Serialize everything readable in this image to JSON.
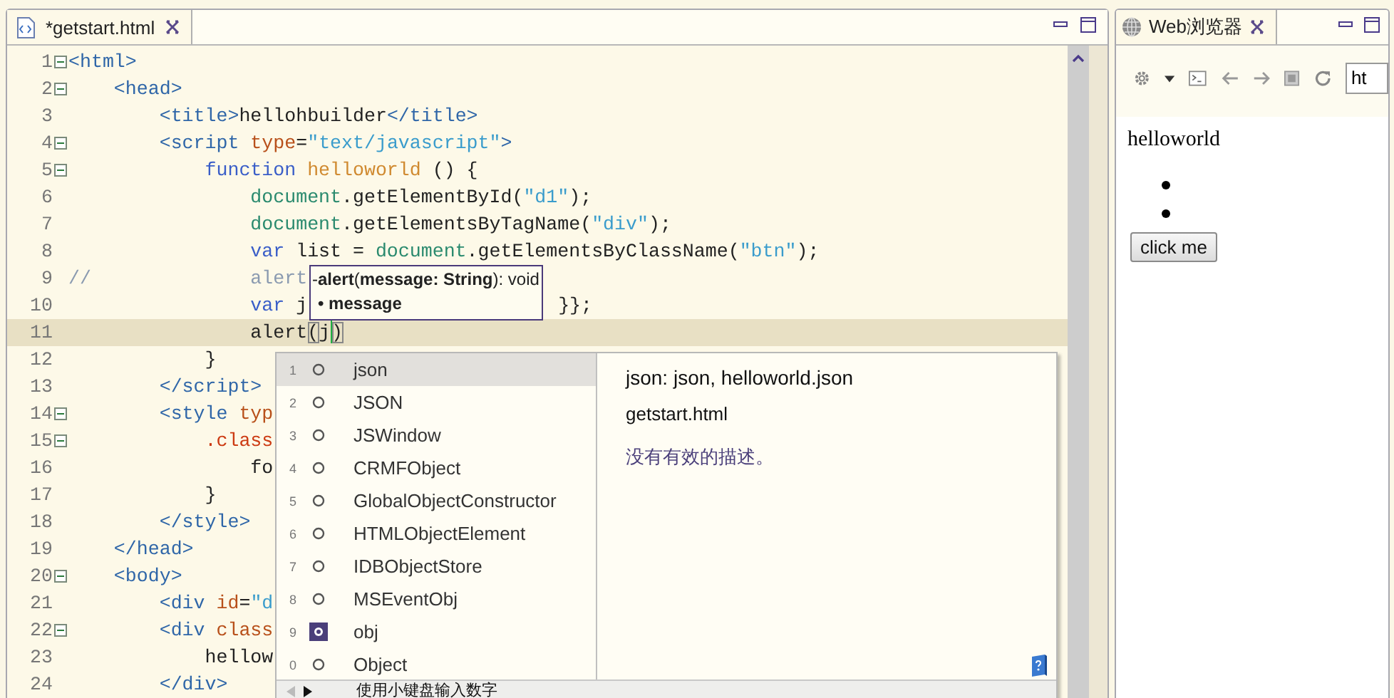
{
  "editor": {
    "tab": {
      "label": "*getstart.html",
      "selected": true
    },
    "lines": [
      {
        "number": "1",
        "fold": true,
        "current": false,
        "tokens": [
          {
            "kind": "tag",
            "text": "<html>"
          }
        ]
      },
      {
        "number": "2",
        "fold": true,
        "current": false,
        "tokens": [
          {
            "kind": "tag",
            "text": "    <head>"
          }
        ]
      },
      {
        "number": "3",
        "fold": false,
        "current": false,
        "tokens": [
          {
            "kind": "tag",
            "text": "        <title>"
          },
          {
            "kind": "plain",
            "text": "hellohbuilder"
          },
          {
            "kind": "tag",
            "text": "</title>"
          }
        ]
      },
      {
        "number": "4",
        "fold": true,
        "current": false,
        "tokens": [
          {
            "kind": "tag",
            "text": "        <script"
          },
          {
            "kind": "attr",
            "text": " type"
          },
          {
            "kind": "plain",
            "text": "="
          },
          {
            "kind": "string",
            "text": "\"text/javascript\""
          },
          {
            "kind": "tag",
            "text": ">"
          }
        ]
      },
      {
        "number": "5",
        "fold": true,
        "current": false,
        "tokens": [
          {
            "kind": "keyword",
            "text": "            function"
          },
          {
            "kind": "fname",
            "text": " helloworld"
          },
          {
            "kind": "plain",
            "text": " () {"
          }
        ]
      },
      {
        "number": "6",
        "fold": false,
        "current": false,
        "tokens": [
          {
            "kind": "object",
            "text": "                document"
          },
          {
            "kind": "plain",
            "text": ".getElementById("
          },
          {
            "kind": "string",
            "text": "\"d1\""
          },
          {
            "kind": "plain",
            "text": ");"
          }
        ]
      },
      {
        "number": "7",
        "fold": false,
        "current": false,
        "tokens": [
          {
            "kind": "object",
            "text": "                document"
          },
          {
            "kind": "plain",
            "text": ".getElementsByTagName("
          },
          {
            "kind": "string",
            "text": "\"div\""
          },
          {
            "kind": "plain",
            "text": ");"
          }
        ]
      },
      {
        "number": "8",
        "fold": false,
        "current": false,
        "tokens": [
          {
            "kind": "keyword",
            "text": "                var"
          },
          {
            "kind": "plain",
            "text": " list = "
          },
          {
            "kind": "object",
            "text": "document"
          },
          {
            "kind": "plain",
            "text": ".getElementsByClassName("
          },
          {
            "kind": "string",
            "text": "\"btn\""
          },
          {
            "kind": "plain",
            "text": ");"
          }
        ]
      },
      {
        "number": "9",
        "fold": false,
        "current": false,
        "tokens": [
          {
            "kind": "comment",
            "text": "//              alert"
          }
        ]
      },
      {
        "number": "10",
        "fold": false,
        "current": false,
        "tokens": [
          {
            "kind": "keyword",
            "text": "                var"
          },
          {
            "kind": "plain",
            "text": " j"
          },
          {
            "kind": "plain",
            "text": "}};",
            "covered_before": true
          }
        ]
      },
      {
        "number": "11",
        "fold": false,
        "current": true,
        "tokens": [
          {
            "kind": "plain",
            "text": "                alert"
          },
          {
            "kind": "bracket",
            "text": "("
          },
          {
            "kind": "plain",
            "text": "j"
          },
          {
            "kind": "caret"
          },
          {
            "kind": "bracket",
            "text": ")"
          }
        ]
      },
      {
        "number": "12",
        "fold": false,
        "current": false,
        "tokens": [
          {
            "kind": "plain",
            "text": "            }"
          }
        ]
      },
      {
        "number": "13",
        "fold": false,
        "current": false,
        "tokens": [
          {
            "kind": "tag",
            "text": "        </script>"
          }
        ]
      },
      {
        "number": "14",
        "fold": true,
        "current": false,
        "tokens": [
          {
            "kind": "tag",
            "text": "        <style"
          },
          {
            "kind": "attr",
            "text": " typ"
          }
        ]
      },
      {
        "number": "15",
        "fold": true,
        "current": false,
        "tokens": [
          {
            "kind": "cssclass",
            "text": "            .class"
          }
        ]
      },
      {
        "number": "16",
        "fold": false,
        "current": false,
        "tokens": [
          {
            "kind": "plain",
            "text": "                fo"
          }
        ]
      },
      {
        "number": "17",
        "fold": false,
        "current": false,
        "tokens": [
          {
            "kind": "plain",
            "text": "            }"
          }
        ]
      },
      {
        "number": "18",
        "fold": false,
        "current": false,
        "tokens": [
          {
            "kind": "tag",
            "text": "        </style>"
          }
        ]
      },
      {
        "number": "19",
        "fold": false,
        "current": false,
        "tokens": [
          {
            "kind": "tag",
            "text": "    </head>"
          }
        ]
      },
      {
        "number": "20",
        "fold": true,
        "current": false,
        "tokens": [
          {
            "kind": "tag",
            "text": "    <body>"
          }
        ]
      },
      {
        "number": "21",
        "fold": false,
        "current": false,
        "tokens": [
          {
            "kind": "tag",
            "text": "        <div"
          },
          {
            "kind": "attr",
            "text": " id"
          },
          {
            "kind": "plain",
            "text": "="
          },
          {
            "kind": "string",
            "text": "\"d"
          }
        ]
      },
      {
        "number": "22",
        "fold": true,
        "current": false,
        "tokens": [
          {
            "kind": "tag",
            "text": "        <div"
          },
          {
            "kind": "attr",
            "text": " class"
          }
        ]
      },
      {
        "number": "23",
        "fold": false,
        "current": false,
        "tokens": [
          {
            "kind": "plain",
            "text": "            hellow"
          }
        ]
      },
      {
        "number": "24",
        "fold": false,
        "current": false,
        "tokens": [
          {
            "kind": "tag",
            "text": "        </div>"
          }
        ]
      }
    ],
    "tooltip": {
      "signature": "-**alert**(**message: String**): void",
      "parameter": "• message"
    },
    "completion": {
      "items": [
        {
          "number": "1",
          "label": "json",
          "kind": "global",
          "selected": true
        },
        {
          "number": "2",
          "label": "JSON",
          "kind": "global",
          "selected": false
        },
        {
          "number": "3",
          "label": "JSWindow",
          "kind": "global",
          "selected": false
        },
        {
          "number": "4",
          "label": "CRMFObject",
          "kind": "global",
          "selected": false
        },
        {
          "number": "5",
          "label": "GlobalObjectConstructor",
          "kind": "global",
          "selected": false
        },
        {
          "number": "6",
          "label": "HTMLObjectElement",
          "kind": "global",
          "selected": false
        },
        {
          "number": "7",
          "label": "IDBObjectStore",
          "kind": "global",
          "selected": false
        },
        {
          "number": "8",
          "label": "MSEventObj",
          "kind": "global",
          "selected": false
        },
        {
          "number": "9",
          "label": "obj",
          "kind": "local",
          "selected": false
        },
        {
          "number": "0",
          "label": "Object",
          "kind": "global",
          "selected": false
        }
      ],
      "detail": {
        "title": "json: json, helloworld.json",
        "file": "getstart.html",
        "description": "没有有效的描述。"
      },
      "hint": "使用小键盘输入数字"
    }
  },
  "browser": {
    "tab": {
      "label": "Web浏览器",
      "selected": true
    },
    "url": "ht",
    "page": {
      "heading": "helloworld",
      "list_items": [
        {
          "kind": "empty"
        },
        {
          "kind": "empty"
        }
      ],
      "button": "click me"
    }
  }
}
